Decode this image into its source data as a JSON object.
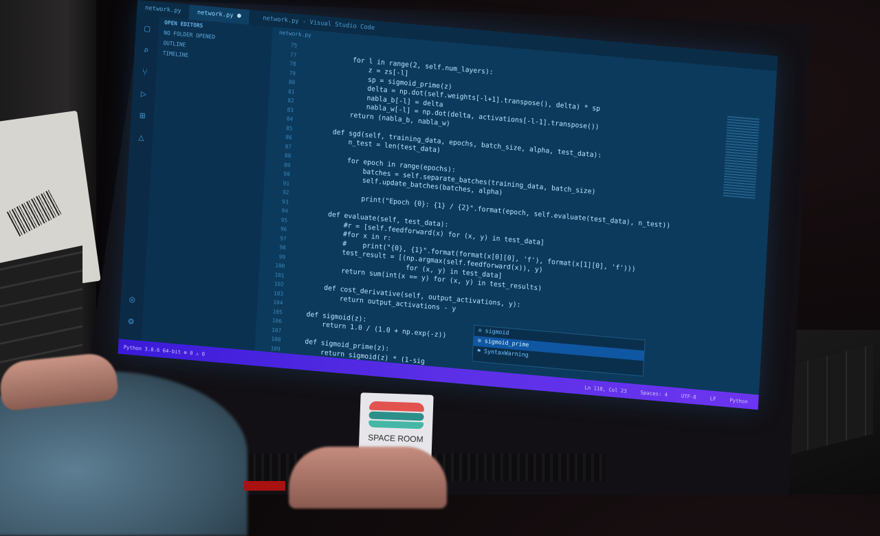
{
  "titlebar": {
    "tabs": [
      {
        "label": "network.py",
        "active": false
      },
      {
        "label": "network.py",
        "active": true
      }
    ],
    "window_title": "network.py - Visual Studio Code"
  },
  "activity_icons": [
    "explorer-icon",
    "search-icon",
    "source-control-icon",
    "debug-icon",
    "extensions-icon",
    "test-icon",
    "account-icon",
    "settings-icon"
  ],
  "sidebar": {
    "header": "OPEN EDITORS",
    "sections": [
      "NO FOLDER OPENED",
      "OUTLINE",
      "TIMELINE"
    ]
  },
  "breadcrumb": "network.py",
  "code": [
    {
      "n": "75",
      "t": ""
    },
    {
      "n": "77",
      "t": "            for l in range(2, self.num_layers):"
    },
    {
      "n": "78",
      "t": "                z = zs[-l]"
    },
    {
      "n": "79",
      "t": "                sp = sigmoid_prime(z)"
    },
    {
      "n": "80",
      "t": "                delta = np.dot(self.weights[-l+1].transpose(), delta) * sp"
    },
    {
      "n": "81",
      "t": "                nabla_b[-l] = delta"
    },
    {
      "n": "82",
      "t": "                nabla_w[-l] = np.dot(delta, activations[-l-1].transpose())"
    },
    {
      "n": "83",
      "t": "            return (nabla_b, nabla_w)"
    },
    {
      "n": "84",
      "t": ""
    },
    {
      "n": "85",
      "t": "        def sgd(self, training_data, epochs, batch_size, alpha, test_data):"
    },
    {
      "n": "86",
      "t": "            n_test = len(test_data)"
    },
    {
      "n": "87",
      "t": ""
    },
    {
      "n": "88",
      "t": "            for epoch in range(epochs):"
    },
    {
      "n": "89",
      "t": "                batches = self.separate_batches(training_data, batch_size)"
    },
    {
      "n": "90",
      "t": "                self.update_batches(batches, alpha)"
    },
    {
      "n": "91",
      "t": ""
    },
    {
      "n": "92",
      "t": "                print(\"Epoch {0}: {1} / {2}\".format(epoch, self.evaluate(test_data), n_test))"
    },
    {
      "n": "93",
      "t": ""
    },
    {
      "n": "94",
      "t": "        def evaluate(self, test_data):"
    },
    {
      "n": "95",
      "t": "            #r = [self.feedforward(x) for (x, y) in test_data]"
    },
    {
      "n": "96",
      "t": "            #for x in r:"
    },
    {
      "n": "97",
      "t": "            #    print(\"{0}, {1}\".format(format(x[0][0], 'f'), format(x[1][0], 'f')))"
    },
    {
      "n": "98",
      "t": "            test_result = [(np.argmax(self.feedforward(x)), y)"
    },
    {
      "n": "99",
      "t": "                            for (x, y) in test_data]"
    },
    {
      "n": "100",
      "t": "            return sum(int(x == y) for (x, y) in test_results)"
    },
    {
      "n": "101",
      "t": ""
    },
    {
      "n": "102",
      "t": "        def cost_derivative(self, output_activations, y):"
    },
    {
      "n": "103",
      "t": "            return output_activations - y"
    },
    {
      "n": "104",
      "t": ""
    },
    {
      "n": "105",
      "t": "    def sigmoid(z):"
    },
    {
      "n": "106",
      "t": "        return 1.0 / (1.0 + np.exp(-z))"
    },
    {
      "n": "107",
      "t": ""
    },
    {
      "n": "108",
      "t": "    def sigmoid_prime(z):"
    },
    {
      "n": "109",
      "t": "        return sigmoid(z) * (1-sig"
    }
  ],
  "suggestions": [
    {
      "label": "sigmoid",
      "selected": false
    },
    {
      "label": "sigmoid_prime",
      "selected": true
    },
    {
      "label": "SyntaxWarning",
      "selected": false
    }
  ],
  "statusbar": {
    "left": "Python 3.8.6 64-bit  ⊗ 0 ⚠ 0",
    "right": [
      "Ln 110, Col 23",
      "Spaces: 4",
      "UTF-8",
      "LF",
      "Python"
    ]
  },
  "sticker": {
    "label": "SPACE ROOM"
  },
  "colors": {
    "statusbar": "#5a2fe6",
    "editor_bg": "#0c3a5c",
    "selection": "#1057a3"
  }
}
